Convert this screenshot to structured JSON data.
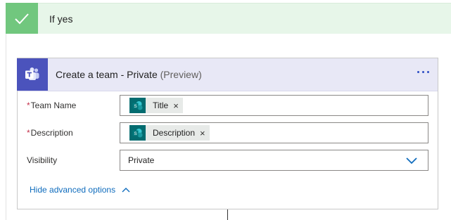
{
  "condition": {
    "title": "If yes"
  },
  "action": {
    "title": "Create a team - Private",
    "suffix": "(Preview)",
    "fields": {
      "team_name": {
        "label": "Team Name",
        "required_mark": "*",
        "token": "Title",
        "token_remove": "×"
      },
      "description": {
        "label": "Description",
        "required_mark": "*",
        "token": "Description",
        "token_remove": "×"
      },
      "visibility": {
        "label": "Visibility",
        "value": "Private"
      }
    },
    "advanced_toggle": "Hide advanced options"
  },
  "colors": {
    "condition_bg": "#e7f6e9",
    "check_tile": "#71c77e",
    "teams_tile": "#4b53bc",
    "card_header_bg": "#e8e8f6",
    "sharepoint_tile": "#036c70",
    "link_blue": "#0f6cbd"
  },
  "icons": {
    "check": "check-icon",
    "teams": "teams-icon",
    "sharepoint": "sharepoint-icon",
    "more": "more-options-icon",
    "chevron_down": "chevron-down-icon",
    "chevron_up": "chevron-up-icon"
  }
}
